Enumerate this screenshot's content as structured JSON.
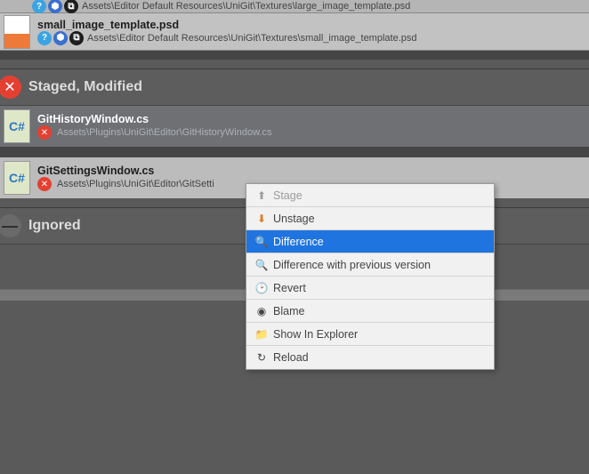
{
  "files": {
    "row0_path": "Assets\\Editor Default Resources\\UniGit\\Textures\\large_image_template.psd",
    "row1_name": "small_image_template.psd",
    "row1_path": "Assets\\Editor Default Resources\\UniGit\\Textures\\small_image_template.psd"
  },
  "sections": {
    "staged": "Staged, Modified",
    "ignored": "Ignored"
  },
  "mod": {
    "row0_name": "GitHistoryWindow.cs",
    "row0_path": "Assets\\Plugins\\UniGit\\Editor\\GitHistoryWindow.cs",
    "row1_name": "GitSettingsWindow.cs",
    "row1_path": "Assets\\Plugins\\UniGit\\Editor\\GitSetti"
  },
  "menu": {
    "stage": "Stage",
    "unstage": "Unstage",
    "difference": "Difference",
    "diff_prev": "Difference with previous version",
    "revert": "Revert",
    "blame": "Blame",
    "show": "Show In Explorer",
    "reload": "Reload"
  },
  "icons": {
    "info": "?",
    "cube": "⬢",
    "tag": "⧉",
    "x": "✕",
    "minus": "—",
    "cs": "C#",
    "arrow_up": "⬆",
    "arrow_down": "⬇",
    "search": "🔍",
    "clock": "🕑",
    "eye": "◉",
    "folder": "📁",
    "reload": "↻"
  }
}
